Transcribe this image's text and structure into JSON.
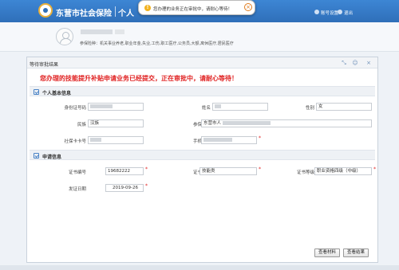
{
  "header": {
    "app_title": "东营市社会保险",
    "app_sub": "个人",
    "toast": {
      "text": "您办理的业务正在审批中，请耐心等待！",
      "icon_glyph": "!",
      "close_glyph": "×"
    },
    "links": {
      "account_settings": "账号设置",
      "logout": "退出"
    }
  },
  "user": {
    "insurance_types": "参保险种：机关事业养老,职业年金,失业,工伤,职工医疗,公务员,大额,离休医疗,居民医疗"
  },
  "panel": {
    "title": "等待审批结果",
    "icons": {
      "shrink": "⤡",
      "user": "☺",
      "close": "×"
    },
    "alert": "您办理的技能提升补贴申请业务已经提交，正在审批中，请耐心等待！",
    "personal_section": {
      "title": "个人基本信息",
      "fields": {
        "id_number": {
          "label": "身份证号码",
          "value": ""
        },
        "name": {
          "label": "姓名",
          "value": ""
        },
        "gender": {
          "label": "性别",
          "value": "女"
        },
        "ethnicity": {
          "label": "民族",
          "value": "汉族"
        },
        "employer": {
          "label": "参保单位",
          "value": "东营市人"
        },
        "ssn": {
          "label": "社保卡卡号",
          "value": ""
        },
        "phone": {
          "label": "手机号码",
          "value": ""
        }
      }
    },
    "application_section": {
      "title": "申请信息",
      "fields": {
        "cert_number": {
          "label": "证书编号",
          "value": "19682222"
        },
        "cert_type": {
          "label": "证书类别",
          "value": "技能类"
        },
        "cert_level": {
          "label": "证书等级",
          "value": "职业资格四级（中级）"
        },
        "issue_date": {
          "label": "发证日期",
          "value": "2019-09-26"
        }
      }
    },
    "buttons": {
      "view_materials": "查看材料",
      "view_result": "查看结果"
    }
  }
}
